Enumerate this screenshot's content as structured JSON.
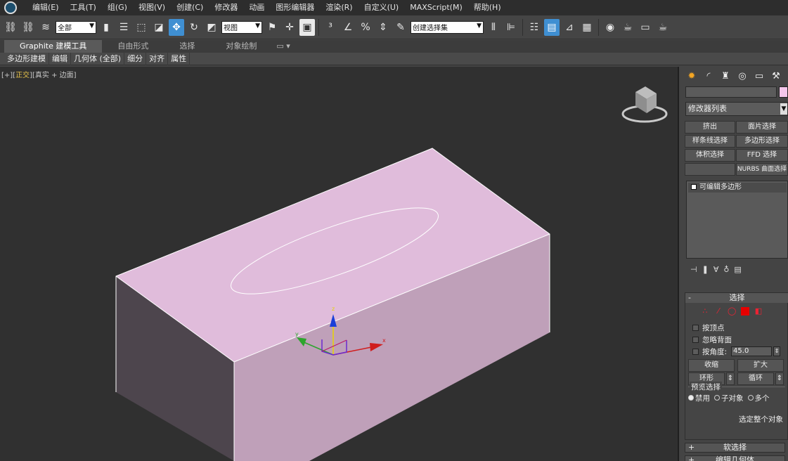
{
  "menubar": {
    "items": [
      "编辑(E)",
      "工具(T)",
      "组(G)",
      "视图(V)",
      "创建(C)",
      "修改器",
      "动画",
      "图形编辑器",
      "渲染(R)",
      "自定义(U)",
      "MAXScript(M)",
      "帮助(H)"
    ]
  },
  "toolbar": {
    "filter_value": "全部",
    "coord_value": "视图",
    "selection_set_value": "创建选择集"
  },
  "ribbon": {
    "tabs": [
      "Graphite 建模工具",
      "自由形式",
      "选择",
      "对象绘制"
    ],
    "subtabs": [
      "多边形建模",
      "编辑",
      "几何体 (全部)",
      "细分",
      "对齐",
      "属性"
    ]
  },
  "viewport": {
    "label_prefix": "[+][",
    "label_view": "正交",
    "label_suffix": "][真实 + 边面]",
    "object_color": "#e3bcdc",
    "axis_labels": {
      "x": "x",
      "y": "y",
      "z": "z"
    }
  },
  "command_panel": {
    "modifier_list": "修改器列表",
    "buttons": [
      "挤出",
      "面片选择",
      "样条线选择",
      "多边形选择",
      "体积选择",
      "FFD 选择",
      "NURBS 曲面选择"
    ],
    "stack_item": "可编辑多边形",
    "selection_rollout": {
      "title": "选择",
      "by_vertex": "按顶点",
      "ignore_backface": "忽略背面",
      "by_angle": "按角度:",
      "angle_value": "45.0",
      "shrink": "收缩",
      "grow": "扩大",
      "ring": "环形",
      "loop": "循环",
      "preview_title": "预览选择",
      "preview_disabled": "禁用",
      "preview_subobject": "子对象",
      "preview_multi": "多个",
      "select_whole": "选定整个对象"
    },
    "soft_selection": "软选择",
    "edit_geometry": "编辑几何体"
  }
}
